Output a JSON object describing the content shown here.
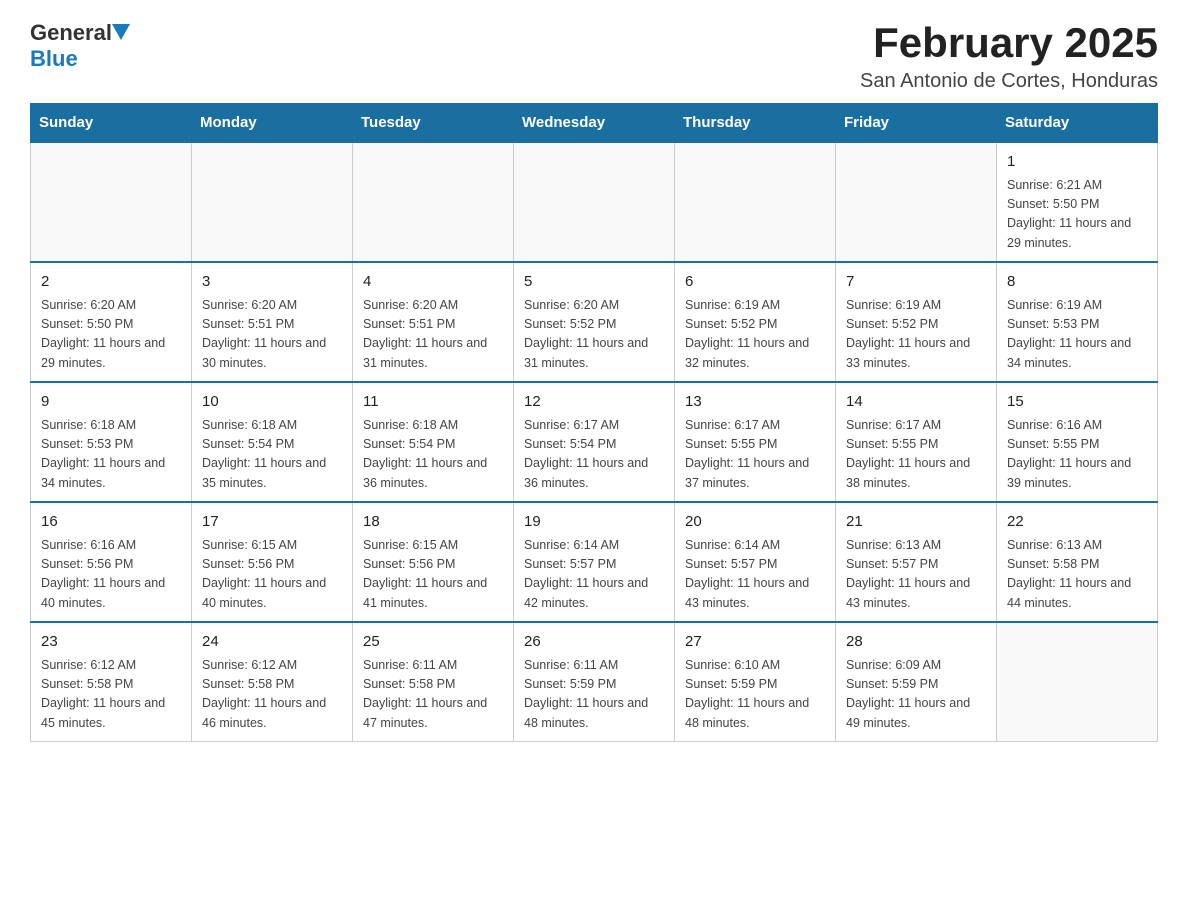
{
  "header": {
    "logo_general": "General",
    "logo_blue": "Blue",
    "month_title": "February 2025",
    "location": "San Antonio de Cortes, Honduras"
  },
  "weekdays": [
    "Sunday",
    "Monday",
    "Tuesday",
    "Wednesday",
    "Thursday",
    "Friday",
    "Saturday"
  ],
  "weeks": [
    [
      {
        "day": "",
        "info": ""
      },
      {
        "day": "",
        "info": ""
      },
      {
        "day": "",
        "info": ""
      },
      {
        "day": "",
        "info": ""
      },
      {
        "day": "",
        "info": ""
      },
      {
        "day": "",
        "info": ""
      },
      {
        "day": "1",
        "info": "Sunrise: 6:21 AM\nSunset: 5:50 PM\nDaylight: 11 hours and 29 minutes."
      }
    ],
    [
      {
        "day": "2",
        "info": "Sunrise: 6:20 AM\nSunset: 5:50 PM\nDaylight: 11 hours and 29 minutes."
      },
      {
        "day": "3",
        "info": "Sunrise: 6:20 AM\nSunset: 5:51 PM\nDaylight: 11 hours and 30 minutes."
      },
      {
        "day": "4",
        "info": "Sunrise: 6:20 AM\nSunset: 5:51 PM\nDaylight: 11 hours and 31 minutes."
      },
      {
        "day": "5",
        "info": "Sunrise: 6:20 AM\nSunset: 5:52 PM\nDaylight: 11 hours and 31 minutes."
      },
      {
        "day": "6",
        "info": "Sunrise: 6:19 AM\nSunset: 5:52 PM\nDaylight: 11 hours and 32 minutes."
      },
      {
        "day": "7",
        "info": "Sunrise: 6:19 AM\nSunset: 5:52 PM\nDaylight: 11 hours and 33 minutes."
      },
      {
        "day": "8",
        "info": "Sunrise: 6:19 AM\nSunset: 5:53 PM\nDaylight: 11 hours and 34 minutes."
      }
    ],
    [
      {
        "day": "9",
        "info": "Sunrise: 6:18 AM\nSunset: 5:53 PM\nDaylight: 11 hours and 34 minutes."
      },
      {
        "day": "10",
        "info": "Sunrise: 6:18 AM\nSunset: 5:54 PM\nDaylight: 11 hours and 35 minutes."
      },
      {
        "day": "11",
        "info": "Sunrise: 6:18 AM\nSunset: 5:54 PM\nDaylight: 11 hours and 36 minutes."
      },
      {
        "day": "12",
        "info": "Sunrise: 6:17 AM\nSunset: 5:54 PM\nDaylight: 11 hours and 36 minutes."
      },
      {
        "day": "13",
        "info": "Sunrise: 6:17 AM\nSunset: 5:55 PM\nDaylight: 11 hours and 37 minutes."
      },
      {
        "day": "14",
        "info": "Sunrise: 6:17 AM\nSunset: 5:55 PM\nDaylight: 11 hours and 38 minutes."
      },
      {
        "day": "15",
        "info": "Sunrise: 6:16 AM\nSunset: 5:55 PM\nDaylight: 11 hours and 39 minutes."
      }
    ],
    [
      {
        "day": "16",
        "info": "Sunrise: 6:16 AM\nSunset: 5:56 PM\nDaylight: 11 hours and 40 minutes."
      },
      {
        "day": "17",
        "info": "Sunrise: 6:15 AM\nSunset: 5:56 PM\nDaylight: 11 hours and 40 minutes."
      },
      {
        "day": "18",
        "info": "Sunrise: 6:15 AM\nSunset: 5:56 PM\nDaylight: 11 hours and 41 minutes."
      },
      {
        "day": "19",
        "info": "Sunrise: 6:14 AM\nSunset: 5:57 PM\nDaylight: 11 hours and 42 minutes."
      },
      {
        "day": "20",
        "info": "Sunrise: 6:14 AM\nSunset: 5:57 PM\nDaylight: 11 hours and 43 minutes."
      },
      {
        "day": "21",
        "info": "Sunrise: 6:13 AM\nSunset: 5:57 PM\nDaylight: 11 hours and 43 minutes."
      },
      {
        "day": "22",
        "info": "Sunrise: 6:13 AM\nSunset: 5:58 PM\nDaylight: 11 hours and 44 minutes."
      }
    ],
    [
      {
        "day": "23",
        "info": "Sunrise: 6:12 AM\nSunset: 5:58 PM\nDaylight: 11 hours and 45 minutes."
      },
      {
        "day": "24",
        "info": "Sunrise: 6:12 AM\nSunset: 5:58 PM\nDaylight: 11 hours and 46 minutes."
      },
      {
        "day": "25",
        "info": "Sunrise: 6:11 AM\nSunset: 5:58 PM\nDaylight: 11 hours and 47 minutes."
      },
      {
        "day": "26",
        "info": "Sunrise: 6:11 AM\nSunset: 5:59 PM\nDaylight: 11 hours and 48 minutes."
      },
      {
        "day": "27",
        "info": "Sunrise: 6:10 AM\nSunset: 5:59 PM\nDaylight: 11 hours and 48 minutes."
      },
      {
        "day": "28",
        "info": "Sunrise: 6:09 AM\nSunset: 5:59 PM\nDaylight: 11 hours and 49 minutes."
      },
      {
        "day": "",
        "info": ""
      }
    ]
  ]
}
